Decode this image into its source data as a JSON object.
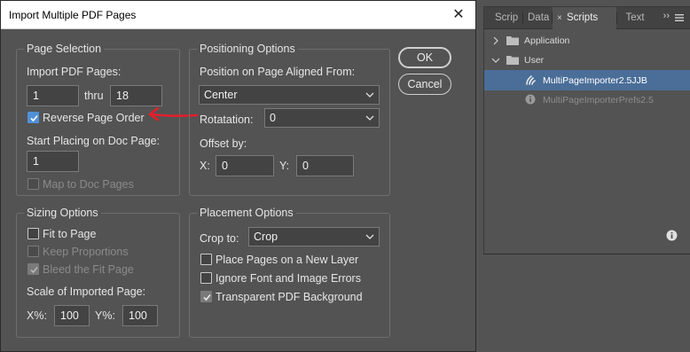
{
  "dialog": {
    "title": "Import Multiple PDF Pages",
    "close_glyph": "✕",
    "ok_label": "OK",
    "cancel_label": "Cancel"
  },
  "page_selection": {
    "legend": "Page Selection",
    "import_label": "Import PDF Pages:",
    "from_value": "1",
    "thru_label": "thru",
    "to_value": "18",
    "reverse_label": "Reverse Page Order",
    "reverse_checked": true,
    "start_label": "Start Placing on Doc Page:",
    "start_value": "1",
    "map_label": "Map to Doc Pages",
    "map_checked": false
  },
  "positioning": {
    "legend": "Positioning Options",
    "aligned_label": "Position on Page Aligned From:",
    "aligned_value": "Center",
    "rotation_label": "Rotatation:",
    "rotation_value": "0",
    "offset_label": "Offset by:",
    "x_label": "X:",
    "x_value": "0",
    "y_label": "Y:",
    "y_value": "0"
  },
  "sizing": {
    "legend": "Sizing Options",
    "fit_label": "Fit to Page",
    "fit_checked": false,
    "keep_label": "Keep Proportions",
    "bleed_label": "Bleed the Fit Page",
    "scale_label": "Scale of Imported Page:",
    "xpct_label": "X%:",
    "xpct_value": "100",
    "ypct_label": "Y%:",
    "ypct_value": "100"
  },
  "placement": {
    "legend": "Placement Options",
    "crop_label": "Crop to:",
    "crop_value": "Crop",
    "new_layer_label": "Place Pages on a New Layer",
    "ignore_label": "Ignore Font and Image Errors",
    "transparent_label": "Transparent PDF Background",
    "transparent_checked": true
  },
  "annotation": {
    "arrow_color": "#e0202a"
  },
  "panel": {
    "tabs": [
      "Scrip",
      "Data",
      "Scripts",
      "Text"
    ],
    "active_tab": "Scripts",
    "more_glyph": "››",
    "folders": [
      "Application",
      "User"
    ],
    "scripts": [
      "MultiPageImporter2.5JJB",
      "MultiPageImporterPrefs2.5"
    ],
    "selected_script": "MultiPageImporter2.5JJB",
    "selection_color": "#4a6e98"
  },
  "colors": {
    "dialog_bg": "#535353",
    "checkbox_accent": "#4f90d6"
  }
}
